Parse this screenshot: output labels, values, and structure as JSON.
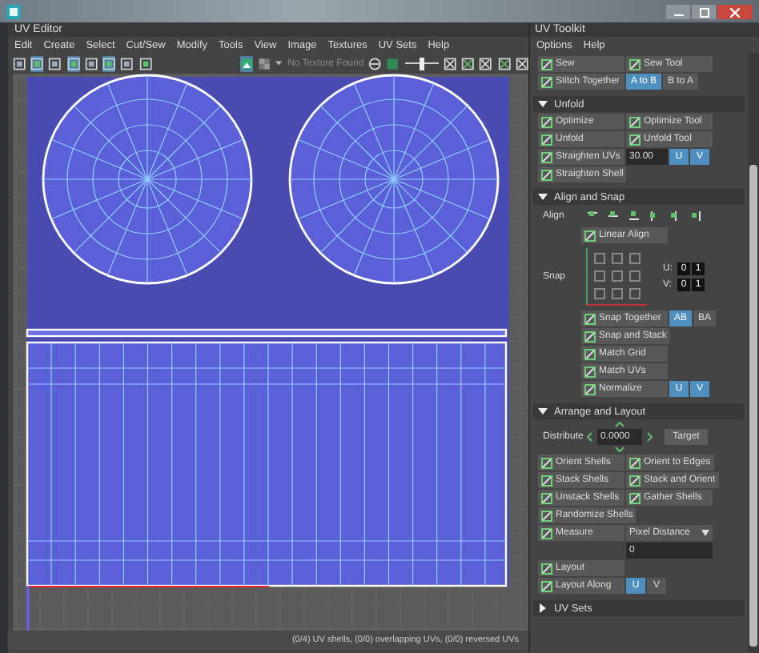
{
  "editor": {
    "title": "UV Editor",
    "menu": [
      "Edit",
      "Create",
      "Select",
      "Cut/Sew",
      "Modify",
      "Tools",
      "View",
      "Image",
      "Textures",
      "UV Sets",
      "Help"
    ],
    "texture_status": "No Texture Found",
    "exposure_slider": {
      "level": 0.5
    },
    "status": "(0/4) UV shells, (0/0) overlapping UVs, (0/0) reversed UVs"
  },
  "toolkit": {
    "title": "UV Toolkit",
    "menu": [
      "Options",
      "Help"
    ],
    "sections": [
      {
        "rows": [
          {
            "items": [
              {
                "kind": "button",
                "label": "Sew"
              },
              {
                "kind": "button",
                "label": "Sew Tool"
              }
            ]
          },
          {
            "items": [
              {
                "kind": "button",
                "label": "Stitch Together"
              },
              {
                "kind": "toggle",
                "label": "A to B",
                "selected": true
              },
              {
                "kind": "toggle",
                "label": "B to A",
                "selected": false
              }
            ]
          }
        ]
      },
      {
        "title": "Unfold",
        "expanded": true,
        "rows": [
          {
            "items": [
              {
                "kind": "button",
                "label": "Optimize"
              },
              {
                "kind": "button",
                "label": "Optimize Tool"
              }
            ]
          },
          {
            "items": [
              {
                "kind": "button",
                "label": "Unfold"
              },
              {
                "kind": "button",
                "label": "Unfold Tool"
              }
            ]
          },
          {
            "items": [
              {
                "kind": "button",
                "label": "Straighten UVs"
              },
              {
                "kind": "field",
                "value": "30.00"
              },
              {
                "kind": "toggle",
                "label": "U",
                "selected": true
              },
              {
                "kind": "toggle",
                "label": "V",
                "selected": true
              }
            ]
          },
          {
            "items": [
              {
                "kind": "button",
                "label": "Straighten Shell"
              }
            ]
          }
        ]
      },
      {
        "title": "Align and Snap",
        "expanded": true,
        "rows": [
          {
            "items": [
              {
                "kind": "label",
                "label": "Align"
              },
              {
                "kind": "align_icons"
              }
            ]
          },
          {
            "items": [
              {
                "kind": "spacer"
              },
              {
                "kind": "button",
                "label": "Linear Align"
              }
            ]
          },
          {
            "items": [
              {
                "kind": "label",
                "label": "Snap"
              },
              {
                "kind": "snap_grid",
                "anchors": [
                  {
                    "checked": false
                  },
                  {
                    "checked": false
                  },
                  {
                    "checked": false
                  },
                  {
                    "checked": false
                  },
                  {
                    "checked": false
                  },
                  {
                    "checked": false
                  },
                  {
                    "checked": false
                  },
                  {
                    "checked": false
                  },
                  {
                    "checked": false
                  }
                ],
                "u_label": "U:",
                "v_label": "V:",
                "u": [
                  "0",
                  "1"
                ],
                "v": [
                  "0",
                  "1"
                ]
              }
            ]
          },
          {
            "items": [
              {
                "kind": "spacer"
              },
              {
                "kind": "button",
                "label": "Snap Together"
              },
              {
                "kind": "toggle",
                "label": "AB",
                "selected": true
              },
              {
                "kind": "toggle",
                "label": "BA",
                "selected": false
              }
            ]
          },
          {
            "items": [
              {
                "kind": "spacer"
              },
              {
                "kind": "button",
                "label": "Snap and Stack"
              }
            ]
          },
          {
            "items": [
              {
                "kind": "spacer"
              },
              {
                "kind": "button",
                "label": "Match Grid"
              }
            ]
          },
          {
            "items": [
              {
                "kind": "spacer"
              },
              {
                "kind": "button",
                "label": "Match UVs"
              }
            ]
          },
          {
            "items": [
              {
                "kind": "spacer"
              },
              {
                "kind": "button",
                "label": "Normalize"
              },
              {
                "kind": "toggle",
                "label": "U",
                "selected": true
              },
              {
                "kind": "toggle",
                "label": "V",
                "selected": true
              }
            ]
          }
        ]
      },
      {
        "title": "Arrange and Layout",
        "expanded": true,
        "rows": [
          {
            "items": [
              {
                "kind": "label",
                "label": "Distribute"
              },
              {
                "kind": "stepper",
                "value": "0.0000"
              },
              {
                "kind": "plain_button",
                "label": "Target"
              }
            ]
          },
          {
            "items": [
              {
                "kind": "button",
                "label": "Orient Shells"
              },
              {
                "kind": "button",
                "label": "Orient to Edges"
              }
            ]
          },
          {
            "items": [
              {
                "kind": "button",
                "label": "Stack Shells"
              },
              {
                "kind": "button",
                "label": "Stack and Orient"
              }
            ]
          },
          {
            "items": [
              {
                "kind": "button",
                "label": "Unstack Shells"
              },
              {
                "kind": "button",
                "label": "Gather Shells"
              }
            ]
          },
          {
            "items": [
              {
                "kind": "button",
                "label": "Randomize Shells"
              }
            ]
          },
          {
            "items": [
              {
                "kind": "button",
                "label": "Measure"
              },
              {
                "kind": "dropdown",
                "value": "Pixel Distance"
              }
            ]
          },
          {
            "items": [
              {
                "kind": "blank"
              },
              {
                "kind": "output_field",
                "value": "0"
              }
            ]
          },
          {
            "items": [
              {
                "kind": "button",
                "label": "Layout"
              }
            ]
          },
          {
            "items": [
              {
                "kind": "button",
                "label": "Layout Along"
              },
              {
                "kind": "toggle",
                "label": "U",
                "selected": true
              },
              {
                "kind": "toggle",
                "label": "V",
                "selected": false
              }
            ]
          }
        ]
      },
      {
        "title": "UV Sets",
        "expanded": false
      }
    ]
  }
}
